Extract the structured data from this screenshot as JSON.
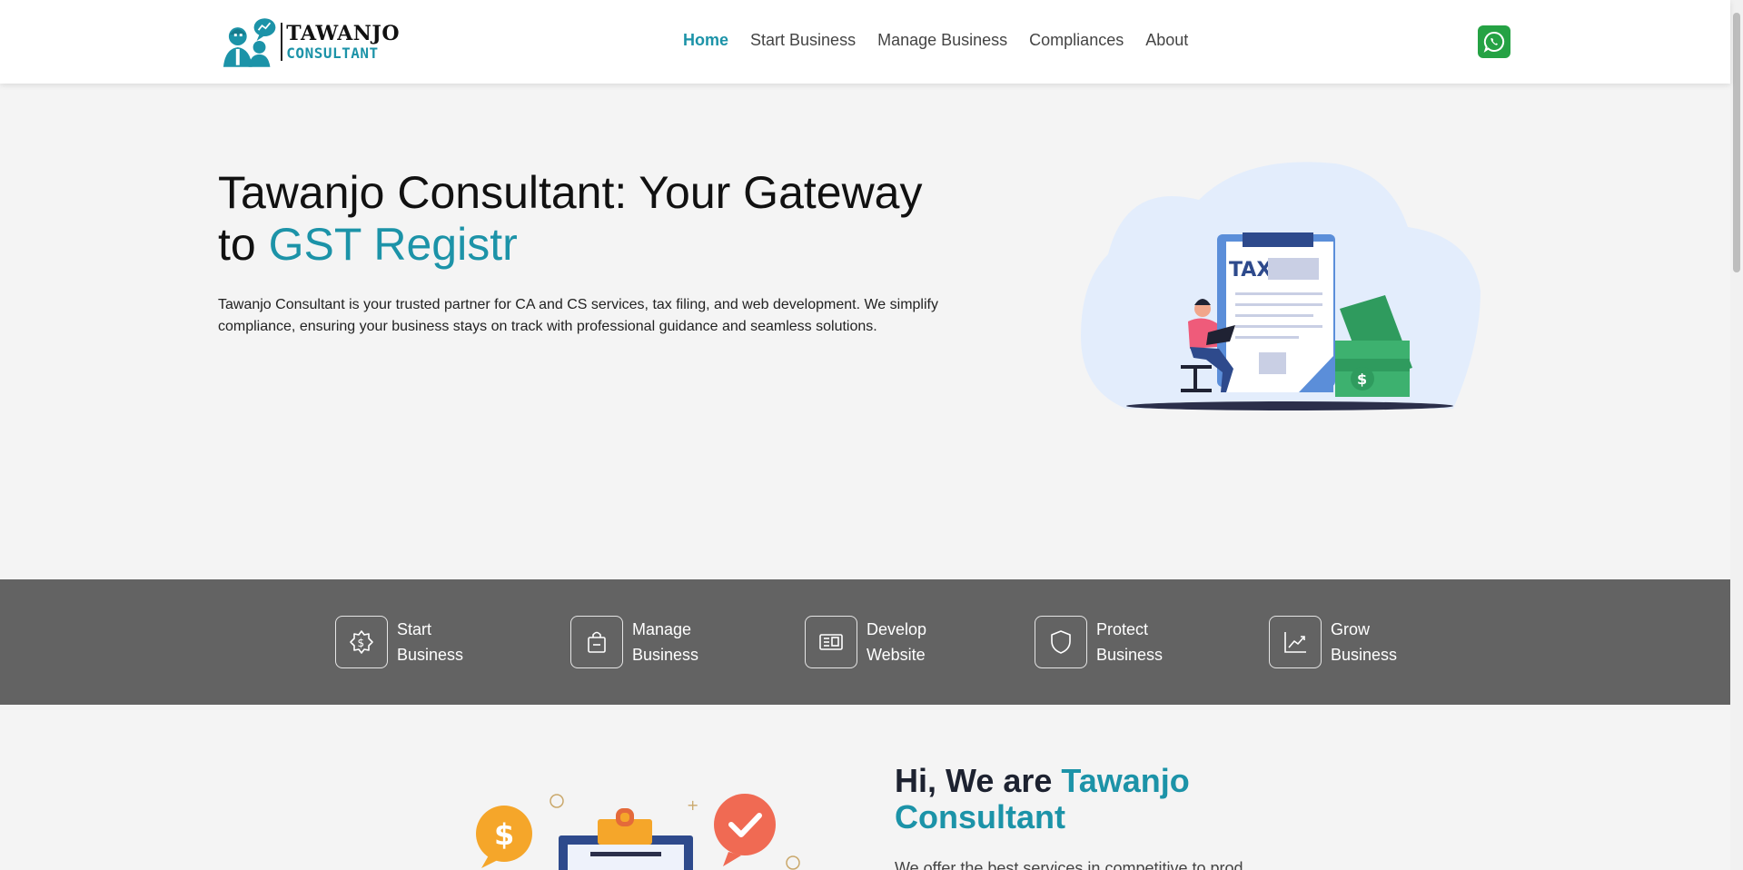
{
  "brand": {
    "name_line1": "TAWANJO",
    "name_line2": "CONSULTANT",
    "primary_color": "#1c93a8"
  },
  "nav": {
    "items": [
      {
        "label": "Home",
        "active": true
      },
      {
        "label": "Start Business",
        "active": false
      },
      {
        "label": "Manage Business",
        "active": false
      },
      {
        "label": "Compliances",
        "active": false
      },
      {
        "label": "About",
        "active": false
      }
    ],
    "whatsapp_icon": "whatsapp-icon"
  },
  "hero": {
    "title_main": "Tawanjo Consultant: Your Gateway to ",
    "title_accent": "GST Registr",
    "description": "Tawanjo Consultant is your trusted partner for CA and CS services, tax filing, and web development. We simplify compliance, ensuring your business stays on track with professional guidance and seamless solutions.",
    "illustration_text": "TAX"
  },
  "services": [
    {
      "line1": "Start",
      "line2": "Business",
      "icon": "dollar-gear-icon"
    },
    {
      "line1": "Manage",
      "line2": "Business",
      "icon": "shopping-bag-icon"
    },
    {
      "line1": "Develop",
      "line2": "Website",
      "icon": "news-icon"
    },
    {
      "line1": "Protect",
      "line2": "Business",
      "icon": "shield-icon"
    },
    {
      "line1": "Grow",
      "line2": "Business",
      "icon": "chart-line-icon"
    }
  ],
  "about": {
    "title_main": "Hi, We are ",
    "title_accent": "Tawanjo Consultant",
    "body_start": "We offer the best services in competitive to prod..."
  }
}
